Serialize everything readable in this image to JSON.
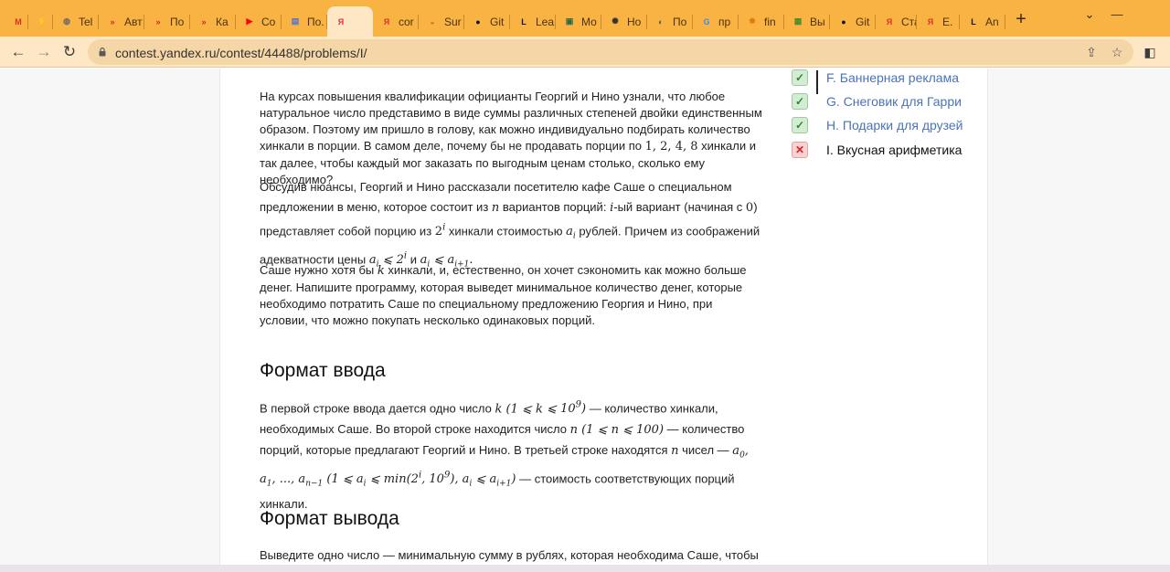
{
  "browser": {
    "tabs": [
      {
        "favicon": "gmail-icon",
        "title": "",
        "color": "#d93025",
        "glyph": "M"
      },
      {
        "favicon": "bolt-icon",
        "title": "",
        "color": "#3a2a10",
        "glyph": "⚡"
      },
      {
        "favicon": "globe-icon",
        "title": "Tel",
        "color": "#666666",
        "glyph": "◍"
      },
      {
        "favicon": "yandex-contest-icon",
        "title": "Авт",
        "color": "#d82020",
        "glyph": "»"
      },
      {
        "favicon": "yandex-contest-icon",
        "title": "По",
        "color": "#d82020",
        "glyph": "»"
      },
      {
        "favicon": "yandex-contest-icon",
        "title": "Ка",
        "color": "#d82020",
        "glyph": "»"
      },
      {
        "favicon": "youtube-icon",
        "title": "Со",
        "color": "#ff0000",
        "glyph": "▶"
      },
      {
        "favicon": "doc-icon",
        "title": "По.",
        "color": "#4a73d8",
        "glyph": "▤"
      },
      {
        "favicon": "yandex-icon",
        "title": "",
        "color": "#e03030",
        "glyph": "Я",
        "active": true
      },
      {
        "favicon": "yandex-icon",
        "title": "cor",
        "color": "#e03030",
        "glyph": "Я"
      },
      {
        "favicon": "sunset-icon",
        "title": "Sur",
        "color": "#e06020",
        "glyph": "◒"
      },
      {
        "favicon": "github-icon",
        "title": "Git",
        "color": "#111111",
        "glyph": "●"
      },
      {
        "favicon": "leetcode-icon",
        "title": "Lea",
        "color": "#111111",
        "glyph": "L"
      },
      {
        "favicon": "monitor-icon",
        "title": "Мо",
        "color": "#2a6a4a",
        "glyph": "▣"
      },
      {
        "favicon": "chatgpt-icon",
        "title": "Но",
        "color": "#333333",
        "glyph": "✺"
      },
      {
        "favicon": "wiki-icon",
        "title": "По",
        "color": "#555555",
        "glyph": "◐"
      },
      {
        "favicon": "google-icon",
        "title": "пр",
        "color": "#4285f4",
        "glyph": "G"
      },
      {
        "favicon": "sun-icon",
        "title": "fin",
        "color": "#e07a10",
        "glyph": "✹"
      },
      {
        "favicon": "book-icon",
        "title": "Вы",
        "color": "#4a8a2a",
        "glyph": "▦"
      },
      {
        "favicon": "github-icon",
        "title": "Git",
        "color": "#111111",
        "glyph": "●"
      },
      {
        "favicon": "yandex-icon",
        "title": "Ста",
        "color": "#e03030",
        "glyph": "Я"
      },
      {
        "favicon": "yandex-icon",
        "title": "Е.",
        "color": "#e03030",
        "glyph": "Я"
      },
      {
        "favicon": "leetcode-icon",
        "title": "An",
        "color": "#111111",
        "glyph": "L"
      }
    ],
    "url": "contest.yandex.ru/contest/44488/problems/I/",
    "accent": "#f9b343"
  },
  "problem": {
    "p1": "На курсах повышения квалификации официанты Георгий и Нино узнали, что любое натуральное число представимо в виде суммы различных степеней двойки единственным образом. Поэтому им пришло в голову, как можно индивидуально подбирать количество хинкали в порции. В самом деле, почему бы не продавать порции по",
    "p1_nums": "1, 2, 4, 8",
    "p1_tail": "хинкали и так далее, чтобы каждый мог заказать по выгодным ценам столько, сколько ему необходимо?",
    "p2_a": "Обсудив нюансы, Георгий и Нино рассказали посетителю кафе Саше о специальном предложении в меню, которое состоит из",
    "p2_b": "вариантов порций:",
    "p2_c": "-ый вариант (начиная с",
    "p2_d": ") представляет собой порцию из",
    "p2_e": "хинкали стоимостью",
    "p2_f": "рублей. Причем из соображений адекватности цены",
    "p2_g": "и",
    "p3": "Саше нужно хотя бы",
    "p3_tail": "хинкали, и, естественно, он хочет сэкономить как можно больше денег. Напишите программу, которая выведет минимальное количество денег, которые необходимо потратить Саше по специальному предложению Георгия и Нино, при условии, что можно покупать несколько одинаковых порций.",
    "input_heading": "Формат ввода",
    "in_a": "В первой строке ввода дается одно число",
    "in_b": "— количество хинкали, необходимых Саше. Во второй строке находится число",
    "in_c": "— количество порций, которые предлагают Георгий и Нино. В третьей строке находятся",
    "in_d": "чисел —",
    "in_e": "— стоимость соответствующих порций хинкали.",
    "output_heading": "Формат вывода",
    "out_a": "Выведите одно число — минимальную сумму в рублях, которая необходима Саше, чтобы"
  },
  "sidebar": {
    "problems": [
      {
        "label": "F.  Баннерная реклама",
        "status": "ok"
      },
      {
        "label": "G. Снеговик для Гарри",
        "status": "ok"
      },
      {
        "label": "H. Подарки для друзей",
        "status": "ok"
      },
      {
        "label": "I. Вкусная арифметика",
        "status": "fail",
        "current": true
      }
    ]
  }
}
